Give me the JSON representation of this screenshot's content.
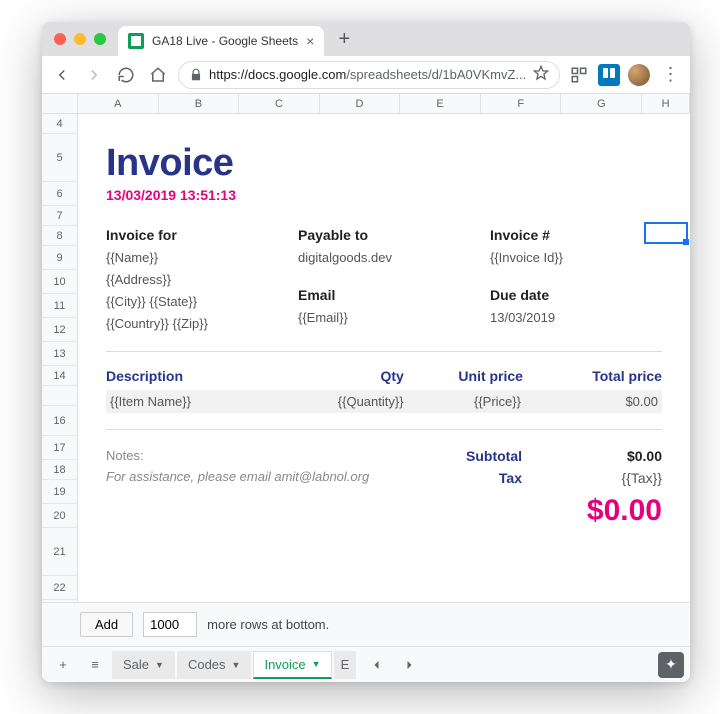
{
  "browser": {
    "tab_title": "GA18 Live - Google Sheets",
    "url_prefix": "https://",
    "url_host": "docs.google.com",
    "url_path": "/spreadsheets/d/1bA0VKmvZ..."
  },
  "columns": [
    "A",
    "B",
    "C",
    "D",
    "E",
    "F",
    "G",
    "H"
  ],
  "rows": [
    "4",
    "5",
    "6",
    "7",
    "8",
    "9",
    "10",
    "11",
    "12",
    "13",
    "14",
    "",
    "16",
    "17",
    "18",
    "19",
    "20",
    "21",
    "22"
  ],
  "invoice": {
    "title": "Invoice",
    "datetime": "13/03/2019 13:51:13",
    "for_label": "Invoice for",
    "for_name": "{{Name}}",
    "for_address": "{{Address}}",
    "for_city_state": "{{City}} {{State}}",
    "for_country_zip": "{{Country}} {{Zip}}",
    "payable_label": "Payable to",
    "payable_value": "digitalgoods.dev",
    "email_label": "Email",
    "email_value": "{{Email}}",
    "invoice_no_label": "Invoice #",
    "invoice_no_value": "{{Invoice Id}}",
    "due_label": "Due date",
    "due_value": "13/03/2019",
    "col_desc": "Description",
    "col_qty": "Qty",
    "col_unit": "Unit price",
    "col_total": "Total price",
    "item_name": "{{Item Name}}",
    "item_qty": "{{Quantity}}",
    "item_price": "{{Price}}",
    "item_total": "$0.00",
    "notes_label": "Notes:",
    "assist": "For assistance, please email amit@labnol.org",
    "subtotal_label": "Subtotal",
    "subtotal_value": "$0.00",
    "tax_label": "Tax",
    "tax_value": "{{Tax}}",
    "grand_total": "$0.00"
  },
  "addrows": {
    "button": "Add",
    "count": "1000",
    "suffix": "more rows at bottom."
  },
  "tabs": {
    "sale": "Sale",
    "codes": "Codes",
    "invoice": "Invoice",
    "extra": "E"
  }
}
